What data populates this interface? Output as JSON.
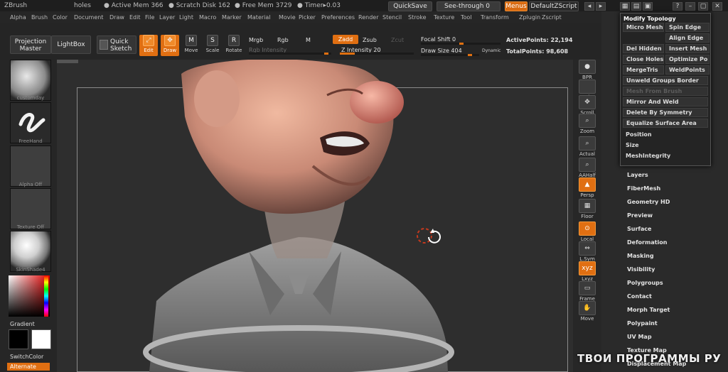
{
  "app": {
    "title": "ZBrush",
    "document": "holes"
  },
  "titlebar": {
    "active_mem": "● Active Mem 366",
    "scratch_disk": "● Scratch Disk 162",
    "free_mem": "● Free Mem 3729",
    "timer": "● Timer▸0.03",
    "quicksave": "QuickSave",
    "see_through": "See-through  0",
    "menus": "Menus",
    "default_zscript": "DefaultZScript"
  },
  "menubar": [
    "Alpha",
    "Brush",
    "Color",
    "Document",
    "Draw",
    "Edit",
    "File",
    "Layer",
    "Light",
    "Macro",
    "Marker",
    "Material",
    "Movie",
    "Picker",
    "Preferences",
    "Render",
    "Stencil",
    "Stroke",
    "Texture",
    "Tool",
    "Transform",
    "Zplugin",
    "Zscript"
  ],
  "shelf": {
    "projection_master": "Projection Master",
    "lightbox": "LightBox",
    "quick_sketch": "Quick Sketch",
    "tools": [
      "Edit",
      "Draw",
      "Move",
      "Scale",
      "Rotate"
    ],
    "mrgb": "Mrgb",
    "rgb": "Rgb",
    "m": "M",
    "rgb_intensity": "Rgb  Intensity",
    "zadd": "Zadd",
    "zsub": "Zsub",
    "zcut": "Zcut",
    "z_intensity": "Z Intensity 20",
    "z_intensity_value": 20,
    "focal_shift": "Focal Shift 0",
    "focal_shift_value": 0,
    "draw_size": "Draw Size 404",
    "draw_size_value": 404,
    "dynamic": "Dynamic",
    "active_points": "ActivePoints: 22,194",
    "total_points": "TotalPoints: 98,608"
  },
  "leftpanel": {
    "brush": "customday",
    "stroke": "FreeHand",
    "alpha": "Alpha  Off",
    "texture": "Texture  Off",
    "material": "SkinShade4",
    "gradient": "Gradient",
    "switch_color": "SwitchColor",
    "alternate": "Alternate"
  },
  "rightstrip": [
    "BPR",
    "SPix",
    "Scroll",
    "Zoom",
    "Actual",
    "AAHalf",
    "Persp",
    "Floor",
    "Local",
    "L.Sym",
    "Lxyz",
    "Frame",
    "Move"
  ],
  "topology": {
    "title": "Modify Topology",
    "items": [
      [
        "Micro Mesh",
        "Spin Edge"
      ],
      [
        "",
        "Align Edge"
      ],
      [
        "Del Hidden",
        "Insert Mesh"
      ],
      [
        "Close Holes",
        "Optimize Po"
      ],
      [
        "MergeTris",
        "WeldPoints"
      ],
      [
        "Unweld Groups Border",
        ""
      ],
      [
        "Mesh From Brush",
        ""
      ],
      [
        "Mirror And Weld",
        ""
      ],
      [
        "Delete By Symmetry",
        ""
      ],
      [
        "Equalize Surface Area",
        ""
      ],
      [
        "Position",
        ""
      ],
      [
        "Size",
        ""
      ],
      [
        "MeshIntegrity",
        ""
      ]
    ]
  },
  "palette": [
    "Layers",
    "FiberMesh",
    "Geometry HD",
    "Preview",
    "Surface",
    "Deformation",
    "Masking",
    "Visibility",
    "Polygroups",
    "Contact",
    "Morph Target",
    "Polypaint",
    "UV Map",
    "Texture Map",
    "Displacement Map"
  ],
  "watermark": "ТВОИ ПРОГРАММЫ РУ",
  "colors": {
    "accent": "#e06f12",
    "background": "#2c2c2c",
    "panel": "#262626"
  }
}
